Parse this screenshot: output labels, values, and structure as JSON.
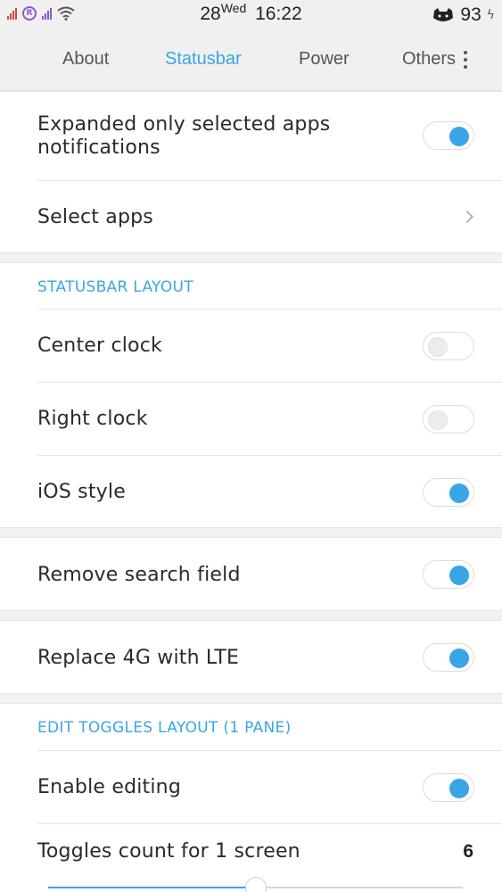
{
  "status_bar": {
    "date": "28",
    "weekday": "Wed",
    "time": "16:22",
    "battery": "93",
    "roaming_glyph": "R",
    "icons": [
      "signal-icon",
      "roaming-icon",
      "signal-icon",
      "wifi-icon",
      "cat-icon",
      "charging-icon"
    ]
  },
  "tabs": [
    {
      "label": "About",
      "active": false
    },
    {
      "label": "Statusbar",
      "active": true
    },
    {
      "label": "Power",
      "active": false
    },
    {
      "label": "Others",
      "active": false
    }
  ],
  "colors": {
    "accent": "#3aa5e6",
    "background": "#f2f2f2",
    "card": "#ffffff"
  },
  "settings": {
    "expanded_only": {
      "label_line1": "Expanded only selected apps",
      "label_line2": "notifications",
      "enabled": true
    },
    "select_apps": {
      "label": "Select apps"
    },
    "statusbar_layout_header": "STATUSBAR LAYOUT",
    "center_clock": {
      "label": "Center clock",
      "enabled": false
    },
    "right_clock": {
      "label": "Right clock",
      "enabled": false
    },
    "ios_style": {
      "label": "iOS style",
      "enabled": true
    },
    "remove_search": {
      "label": "Remove search field",
      "enabled": true
    },
    "replace_4g": {
      "label": "Replace 4G with LTE",
      "enabled": true
    },
    "edit_toggles_header": "EDIT TOGGLES LAYOUT (1 PANE)",
    "enable_editing": {
      "label": "Enable editing",
      "enabled": true
    },
    "toggles_count": {
      "label": "Toggles count for 1 screen",
      "value": "6",
      "slider_fraction": 0.5
    }
  }
}
